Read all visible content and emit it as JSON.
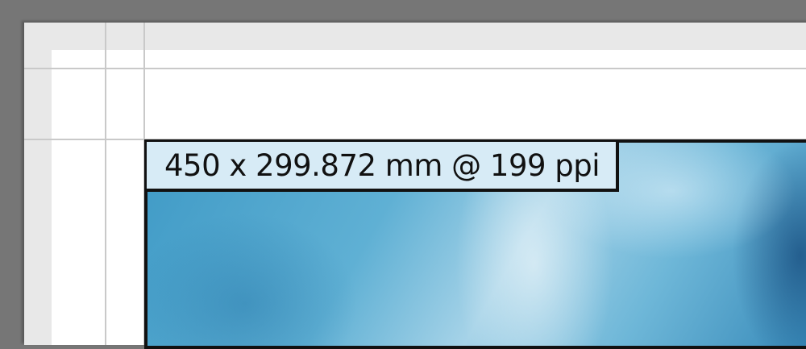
{
  "canvas": {
    "pasteboard_color": "#767676",
    "page_color": "#ffffff",
    "bleed_color": "#e8e8e8",
    "guide_color": "#c9c9c9"
  },
  "placed_image": {
    "frame_color": "#111111",
    "badge_background": "#d7ebf6",
    "dimension_label": "450 x 299.872 mm @ 199 ppi"
  }
}
